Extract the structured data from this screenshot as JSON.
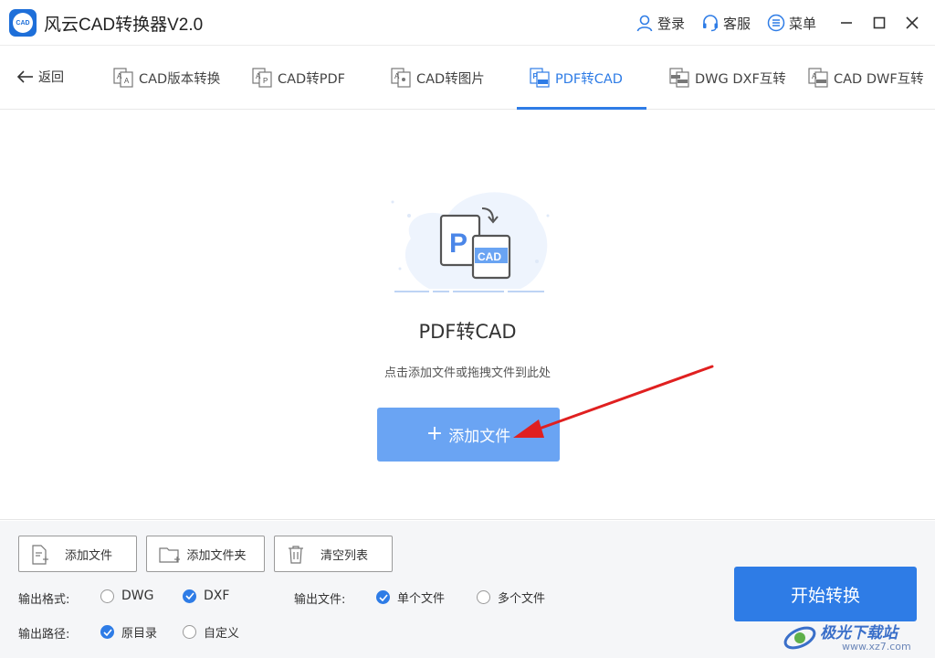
{
  "app": {
    "logo_text": "CAD",
    "title": "风云CAD转换器V2.0",
    "login": "登录",
    "service": "客服",
    "menu": "菜单"
  },
  "nav": {
    "back": "返回",
    "tabs": [
      {
        "label": "CAD版本转换",
        "active": false
      },
      {
        "label": "CAD转PDF",
        "active": false
      },
      {
        "label": "CAD转图片",
        "active": false
      },
      {
        "label": "PDF转CAD",
        "active": true
      },
      {
        "label": "DWG DXF互转",
        "active": false
      },
      {
        "label": "CAD DWF互转",
        "active": false
      }
    ]
  },
  "main": {
    "illustration_p": "P",
    "illustration_cad": "CAD",
    "title": "PDF转CAD",
    "hint": "点击添加文件或拖拽文件到此处",
    "add_button": "添加文件"
  },
  "toolbar": {
    "add_file": "添加文件",
    "add_folder": "添加文件夹",
    "clear_list": "清空列表"
  },
  "options": {
    "format_label": "输出格式:",
    "format_dwg": "DWG",
    "format_dxf": "DXF",
    "format_selected": "DXF",
    "file_label": "输出文件:",
    "file_single": "单个文件",
    "file_multi": "多个文件",
    "file_selected": "单个文件",
    "path_label": "输出路径:",
    "path_original": "原目录",
    "path_custom": "自定义",
    "path_selected": "原目录"
  },
  "start_button": "开始转换",
  "watermark": {
    "text": "极光下载站",
    "url": "www.xz7.com"
  },
  "colors": {
    "accent": "#2e7ce6",
    "add_button": "#6aa4f3",
    "arrow": "#e02020"
  }
}
